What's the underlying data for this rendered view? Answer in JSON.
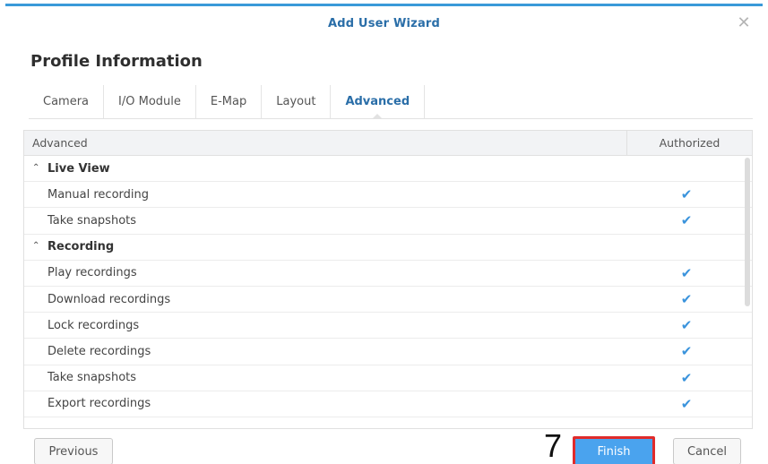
{
  "window": {
    "title": "Add User Wizard"
  },
  "section_title": "Profile Information",
  "tabs": [
    {
      "label": "Camera",
      "active": false
    },
    {
      "label": "I/O Module",
      "active": false
    },
    {
      "label": "E-Map",
      "active": false
    },
    {
      "label": "Layout",
      "active": false
    },
    {
      "label": "Advanced",
      "active": true
    }
  ],
  "grid": {
    "columns": {
      "name": "Advanced",
      "authorized": "Authorized"
    },
    "groups": [
      {
        "label": "Live View",
        "items": [
          {
            "label": "Manual recording",
            "authorized": "✔"
          },
          {
            "label": "Take snapshots",
            "authorized": "✔"
          }
        ]
      },
      {
        "label": "Recording",
        "items": [
          {
            "label": "Play recordings",
            "authorized": "✔"
          },
          {
            "label": "Download recordings",
            "authorized": "✔"
          },
          {
            "label": "Lock recordings",
            "authorized": "✔"
          },
          {
            "label": "Delete recordings",
            "authorized": "✔"
          },
          {
            "label": "Take snapshots",
            "authorized": "✔"
          },
          {
            "label": "Export recordings",
            "authorized": "✔"
          }
        ]
      }
    ]
  },
  "footer": {
    "previous_label": "Previous",
    "finish_label": "Finish",
    "cancel_label": "Cancel",
    "step_annotation": "7"
  },
  "colors": {
    "accent": "#3a9ad9",
    "title": "#2a6ea8",
    "check": "#3a93dc",
    "finish_bg": "#4aa3ee",
    "highlight": "#e02b2b"
  },
  "icons": {
    "close": "close-icon",
    "collapse": "chevron-up-icon",
    "check": "check-icon"
  }
}
